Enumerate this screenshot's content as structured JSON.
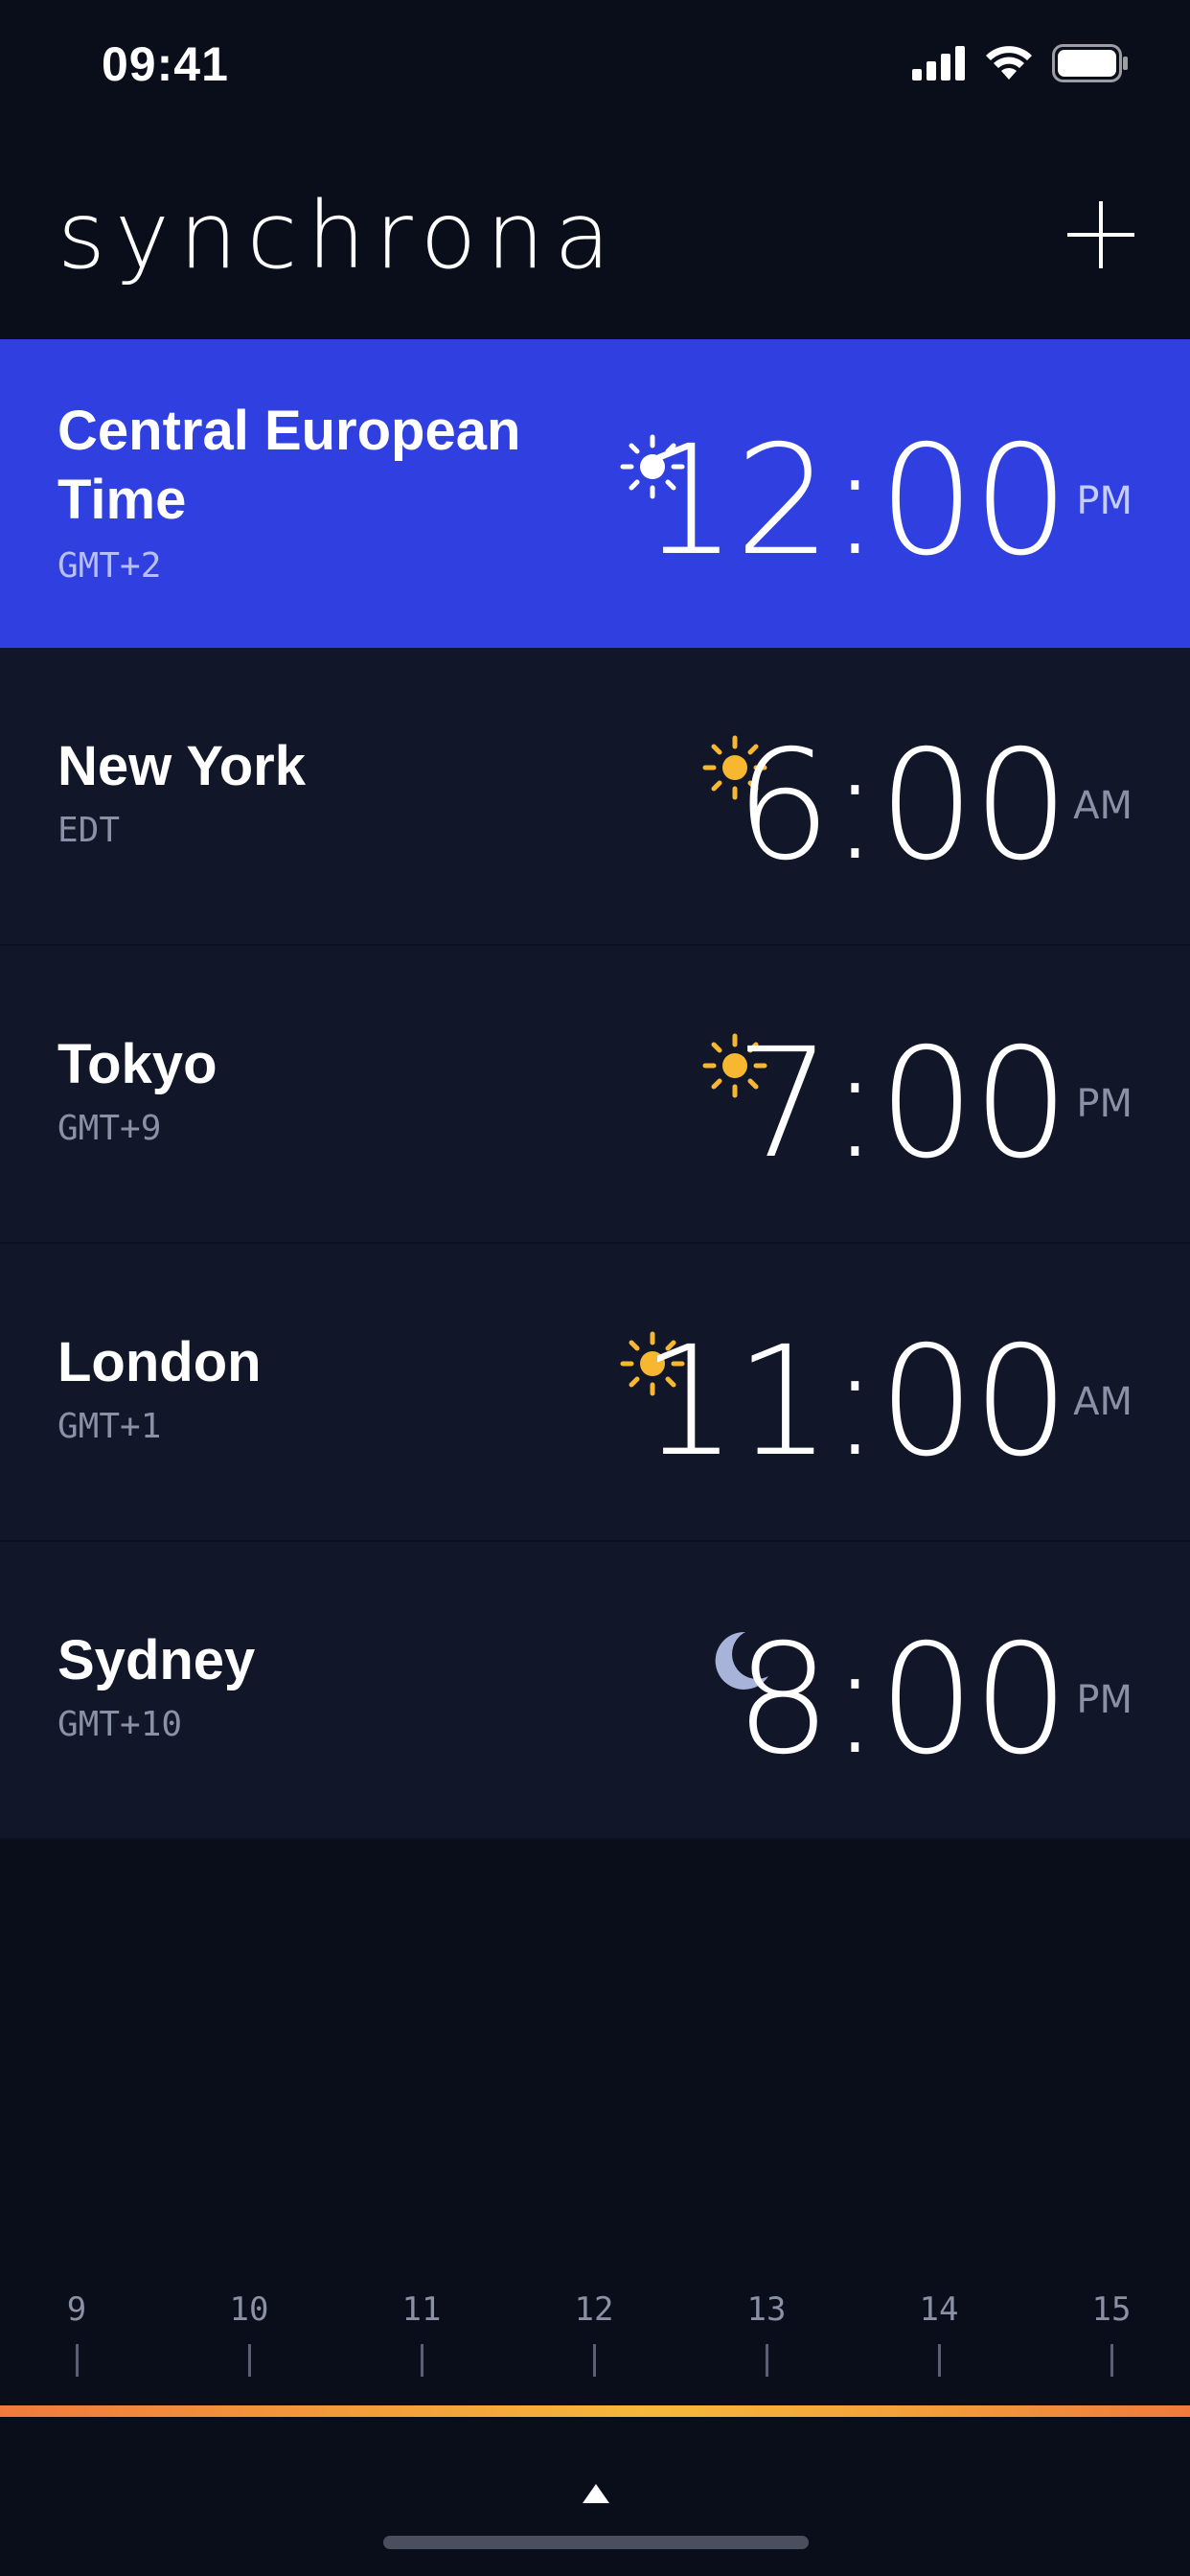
{
  "status_bar": {
    "time": "09:41"
  },
  "app": {
    "title": "synchrona"
  },
  "colors": {
    "accent": "#3040e0",
    "sun": "#f7b731",
    "moon": "#a7b3d9",
    "row_bg": "#111729",
    "bg": "#0a0e1a"
  },
  "zones": [
    {
      "name": "Central European Time",
      "offset": "GMT+2",
      "time": "12:00",
      "ampm": "PM",
      "icon": "sun-icon",
      "active": true
    },
    {
      "name": "New York",
      "offset": "EDT",
      "time": "6:00",
      "ampm": "AM",
      "icon": "sun-icon",
      "active": false
    },
    {
      "name": "Tokyo",
      "offset": "GMT+9",
      "time": "7:00",
      "ampm": "PM",
      "icon": "sun-icon",
      "active": false
    },
    {
      "name": "London",
      "offset": "GMT+1",
      "time": "11:00",
      "ampm": "AM",
      "icon": "sun-icon",
      "active": false
    },
    {
      "name": "Sydney",
      "offset": "GMT+10",
      "time": "8:00",
      "ampm": "PM",
      "icon": "moon-icon",
      "active": false
    }
  ],
  "timeline": {
    "ticks": [
      "9",
      "10",
      "11",
      "12",
      "13",
      "14",
      "15"
    ]
  }
}
